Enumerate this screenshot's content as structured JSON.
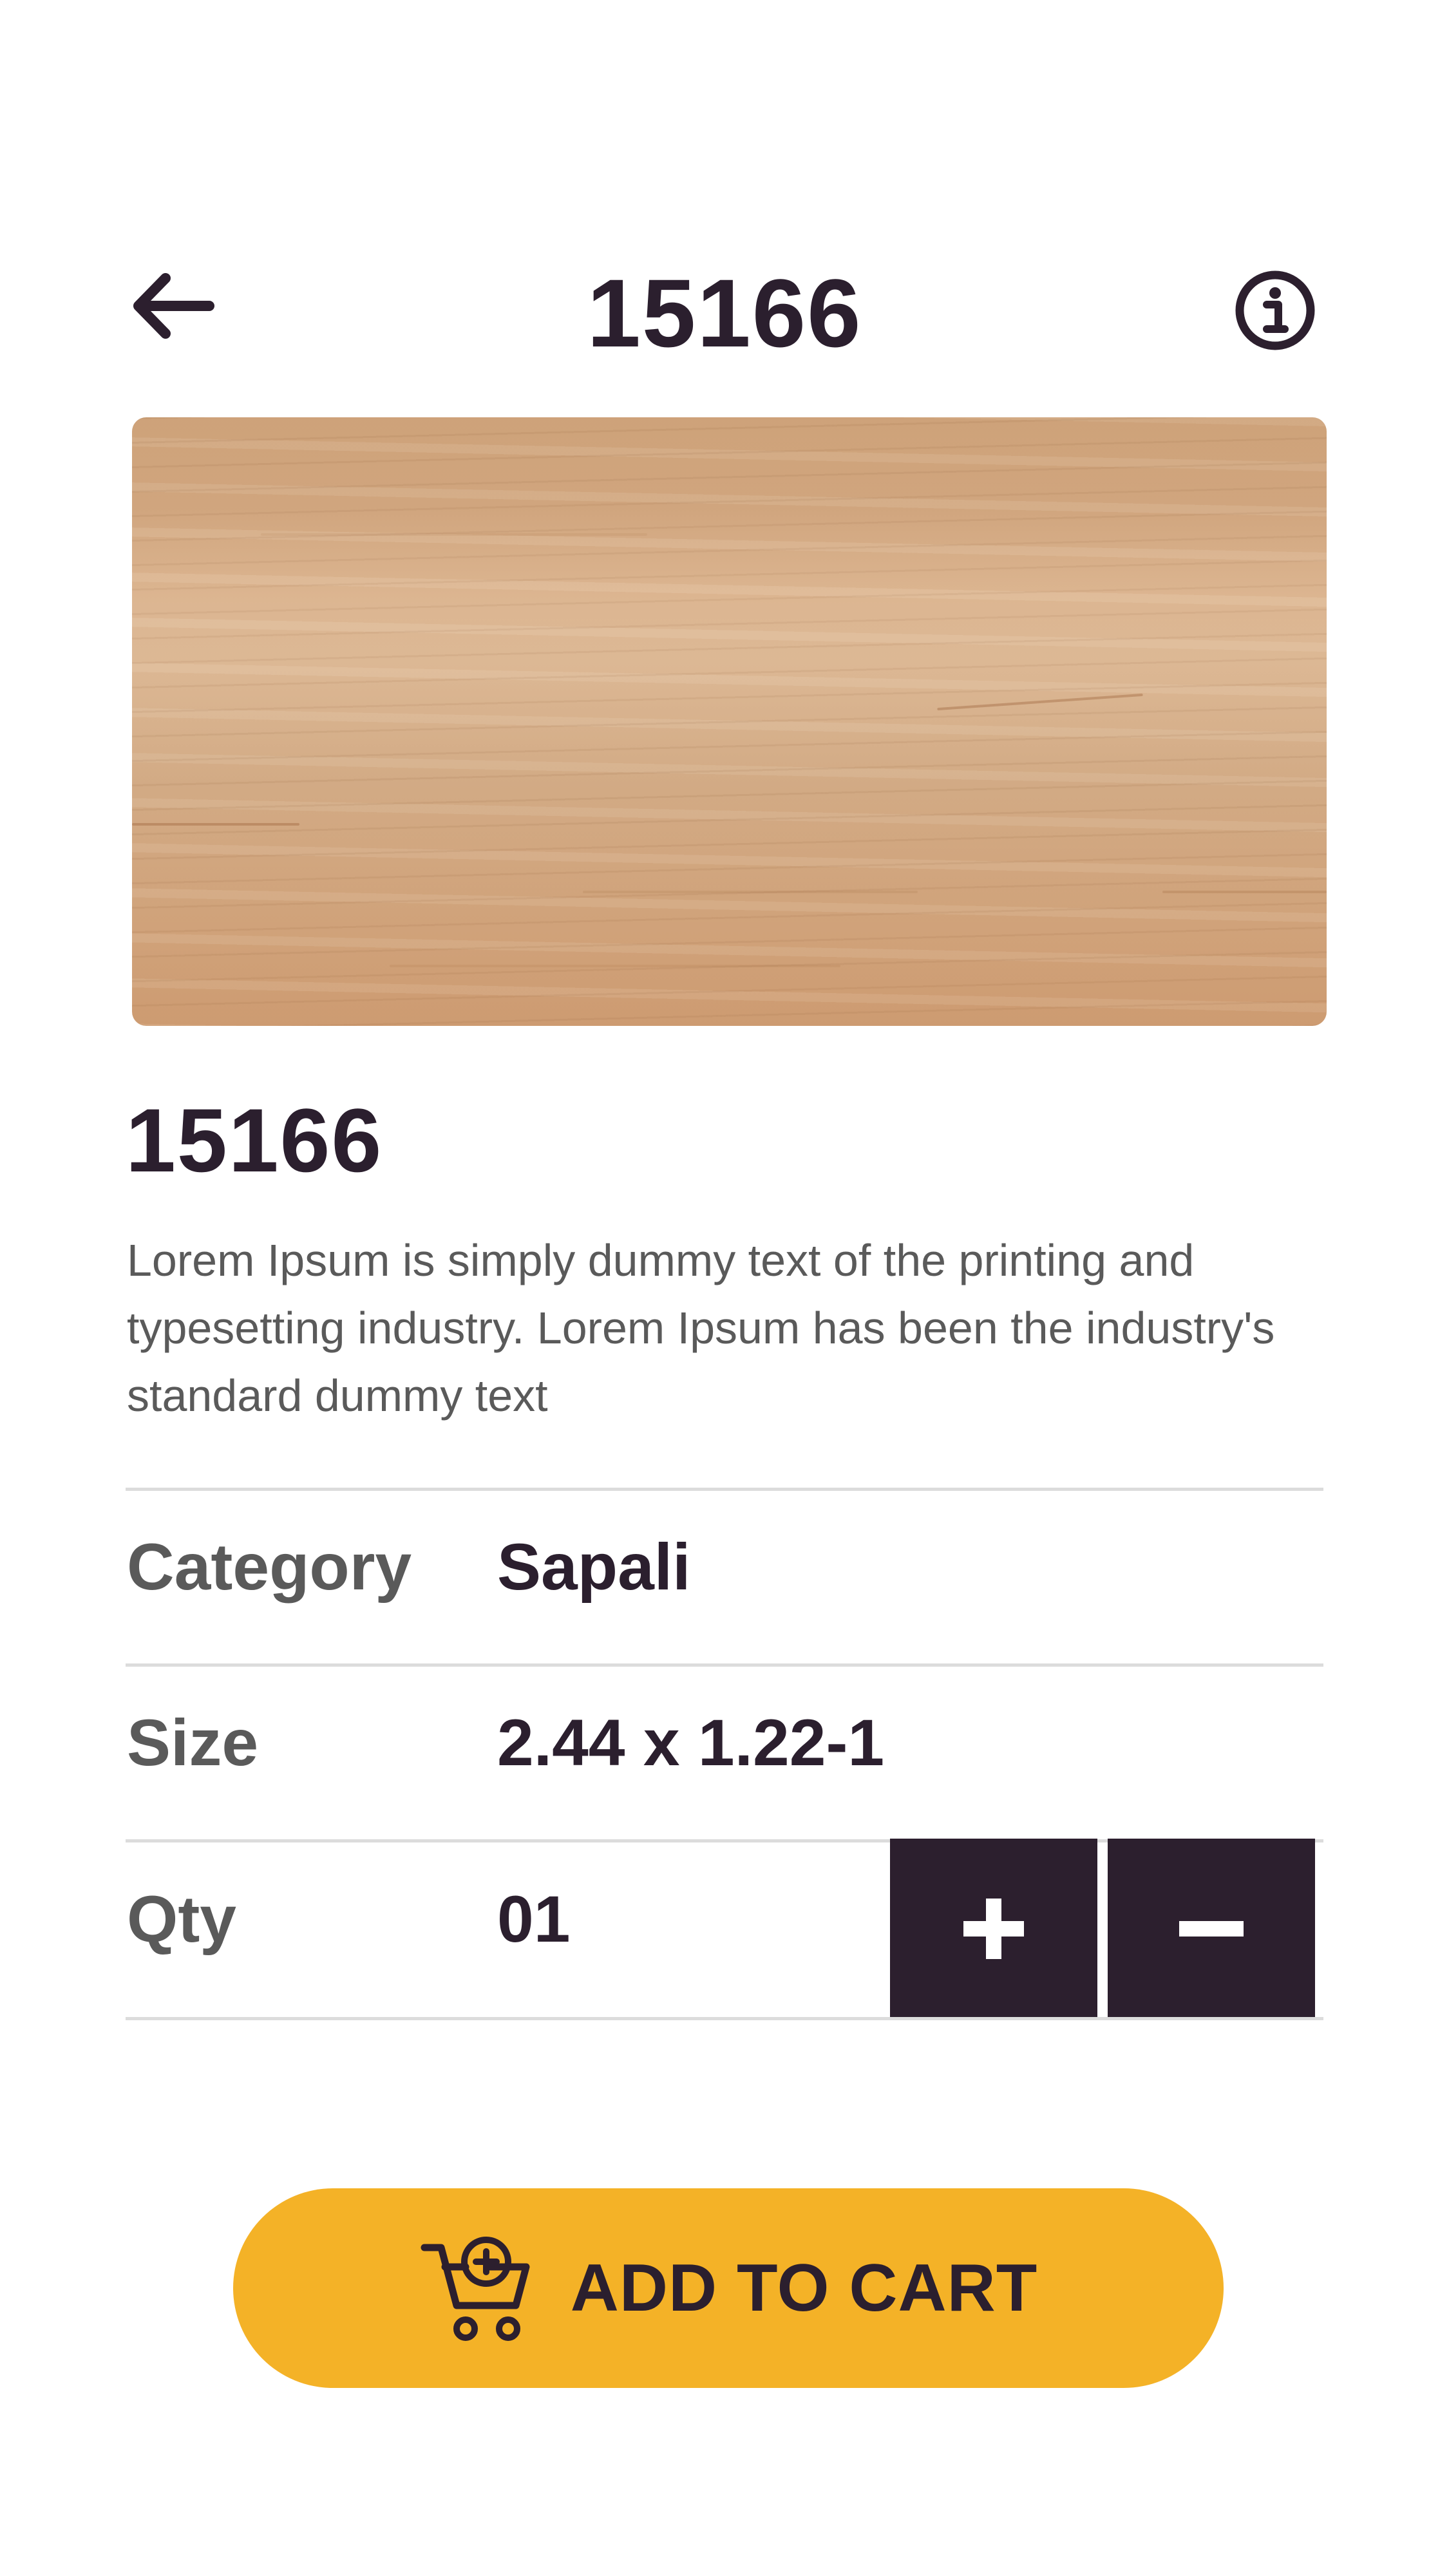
{
  "header": {
    "title": "15166",
    "back_icon": "arrow-left-icon",
    "info_icon": "info-circle-icon"
  },
  "product": {
    "image": "wood-texture",
    "name": "15166",
    "description": "Lorem Ipsum is simply dummy text of the printing and typesetting industry. Lorem Ipsum has been the industry's standard dummy text"
  },
  "details": {
    "category_label": "Category",
    "category_value": "Sapali",
    "size_label": "Size",
    "size_value": "2.44 x 1.22-1",
    "qty_label": "Qty",
    "qty_value": "01",
    "plus_icon": "plus-icon",
    "minus_icon": "minus-icon"
  },
  "cart": {
    "label": "ADD TO CART",
    "icon": "cart-add-icon"
  },
  "colors": {
    "primary_dark": "#2c1f2e",
    "accent": "#f4b227",
    "text_muted": "#5a5a5a",
    "divider": "#dcdcdc"
  }
}
